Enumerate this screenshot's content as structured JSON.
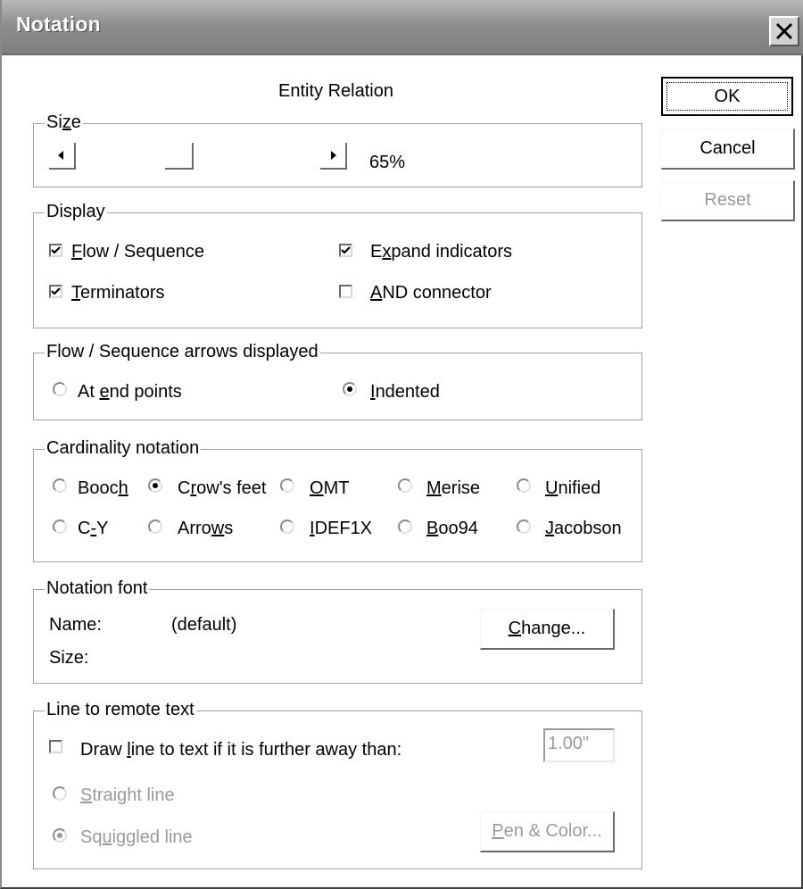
{
  "window": {
    "title": "Notation"
  },
  "header": {
    "subtitle": "Entity Relation"
  },
  "buttons": {
    "ok": "OK",
    "cancel": "Cancel",
    "reset": "Reset"
  },
  "size_group": {
    "legend": "Size",
    "value_text": "65%"
  },
  "display_group": {
    "legend": "Display",
    "flow_sequence": {
      "label": "Flow / Sequence",
      "checked": true
    },
    "expand_indicators": {
      "label": "Expand indicators",
      "checked": true
    },
    "terminators": {
      "label": "Terminators",
      "checked": true
    },
    "and_connector": {
      "label": "AND connector",
      "checked": false
    }
  },
  "arrows_group": {
    "legend": "Flow / Sequence arrows displayed",
    "at_end_points": "At end points",
    "indented": "Indented",
    "selected": "Indented"
  },
  "cardinality_group": {
    "legend": "Cardinality notation",
    "options": [
      "Booch",
      "Crow's feet",
      "OMT",
      "Merise",
      "Unified",
      "C-Y",
      "Arrows",
      "IDEF1X",
      "Boo94",
      "Jacobson"
    ],
    "selected": "Crow's feet"
  },
  "font_group": {
    "legend": "Notation font",
    "name_label": "Name:",
    "name_value": "(default)",
    "size_label": "Size:",
    "change_button": "Change..."
  },
  "remote_text_group": {
    "legend": "Line to remote text",
    "draw_line_label": "Draw line to text if it is further away than:",
    "draw_line_checked": false,
    "distance_value": "1.00\"",
    "straight_line": "Straight line",
    "squiggled_line": "Squiggled line",
    "selected": "Squiggled line",
    "pen_color_button": "Pen & Color..."
  },
  "icons": {
    "close": "close-icon",
    "scroll_left": "arrow-left-icon",
    "scroll_right": "arrow-right-icon"
  }
}
